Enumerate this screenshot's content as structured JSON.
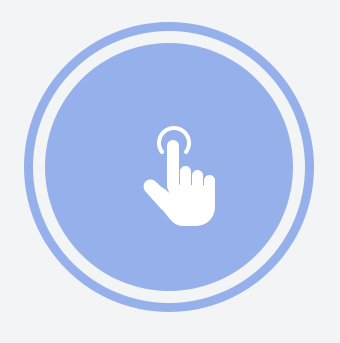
{
  "tap_control": {
    "icon": "tap-hand-icon",
    "colors": {
      "background": "#f3f4f6",
      "accent": "#95b0eb",
      "icon": "#ffffff"
    }
  }
}
